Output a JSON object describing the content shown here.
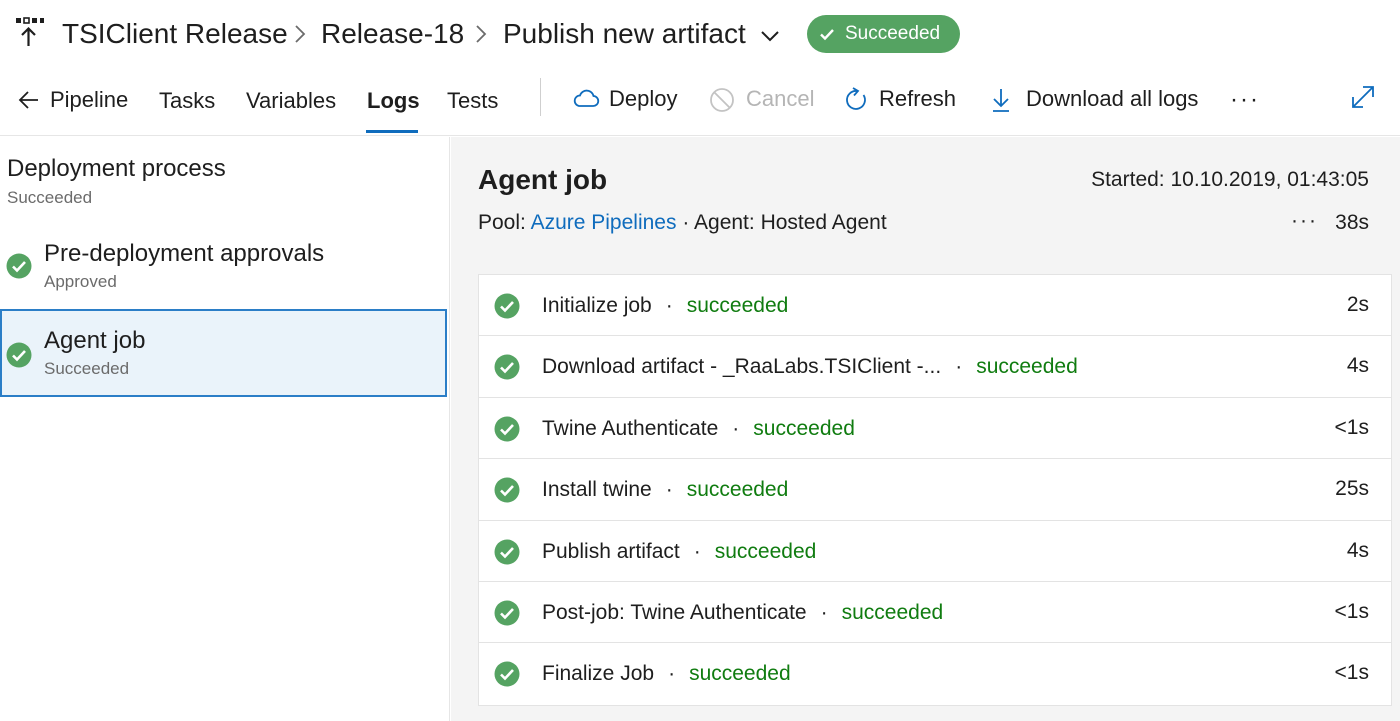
{
  "header": {
    "breadcrumbs": [
      "TSIClient Release",
      "Release-18",
      "Publish new artifact"
    ],
    "status_badge": "Succeeded"
  },
  "toolbar": {
    "back_label": "Pipeline",
    "tabs": [
      "Tasks",
      "Variables",
      "Logs",
      "Tests"
    ],
    "active_tab": "Logs",
    "deploy_label": "Deploy",
    "cancel_label": "Cancel",
    "refresh_label": "Refresh",
    "download_label": "Download all logs",
    "more_label": "···"
  },
  "left_panel": {
    "section_title": "Deployment process",
    "section_status": "Succeeded",
    "items": [
      {
        "title": "Pre-deployment approvals",
        "status": "Approved"
      },
      {
        "title": "Agent job",
        "status": "Succeeded"
      }
    ]
  },
  "job": {
    "title": "Agent job",
    "started": "Started: 10.10.2019, 01:43:05",
    "pool_label": "Pool:",
    "pool_link": "Azure Pipelines",
    "separator": "·",
    "agent": "Agent: Hosted Agent",
    "more": "···",
    "duration": "38s"
  },
  "steps": [
    {
      "name": "Initialize job",
      "status": "succeeded",
      "duration": "2s"
    },
    {
      "name": "Download artifact - _RaaLabs.TSIClient -...",
      "status": "succeeded",
      "duration": "4s"
    },
    {
      "name": "Twine Authenticate",
      "status": "succeeded",
      "duration": "<1s"
    },
    {
      "name": "Install twine",
      "status": "succeeded",
      "duration": "25s"
    },
    {
      "name": "Publish artifact",
      "status": "succeeded",
      "duration": "4s"
    },
    {
      "name": "Post-job: Twine Authenticate",
      "status": "succeeded",
      "duration": "<1s"
    },
    {
      "name": "Finalize Job",
      "status": "succeeded",
      "duration": "<1s"
    }
  ],
  "colors": {
    "success": "#55a362",
    "success_text": "#107c10",
    "link": "#0f6cbd",
    "selected_border": "#2b7ec7",
    "selected_bg": "#eaf3fa"
  }
}
